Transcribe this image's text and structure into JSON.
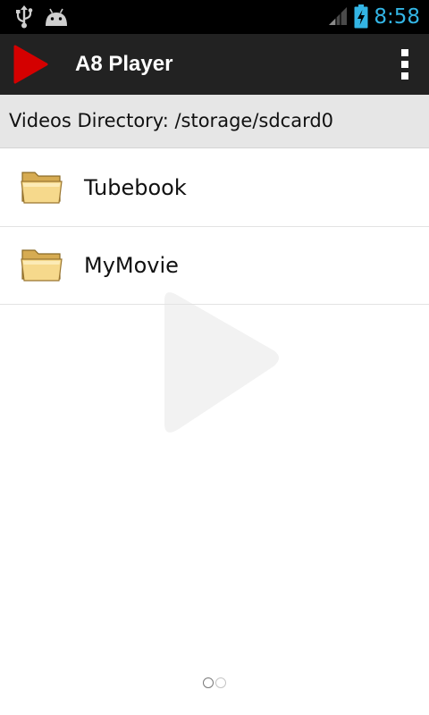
{
  "status_bar": {
    "time": "8:58",
    "icons": [
      "usb-icon",
      "android-debug-icon",
      "signal-icon",
      "battery-charging-icon"
    ],
    "clock_color": "#33b5e5"
  },
  "action_bar": {
    "title": "A8 Player",
    "logo_icon": "play-logo-icon",
    "menu_icon": "overflow-menu-icon",
    "logo_color": "#d40000",
    "background": "#222222"
  },
  "directory": {
    "label": "Videos Directory: /storage/sdcard0"
  },
  "folders": [
    {
      "name": "Tubebook",
      "icon": "folder-icon"
    },
    {
      "name": "MyMovie",
      "icon": "folder-icon"
    }
  ],
  "watermark": {
    "icon": "play-watermark-icon"
  },
  "page_indicator": {
    "pages": 2,
    "current": 1
  }
}
